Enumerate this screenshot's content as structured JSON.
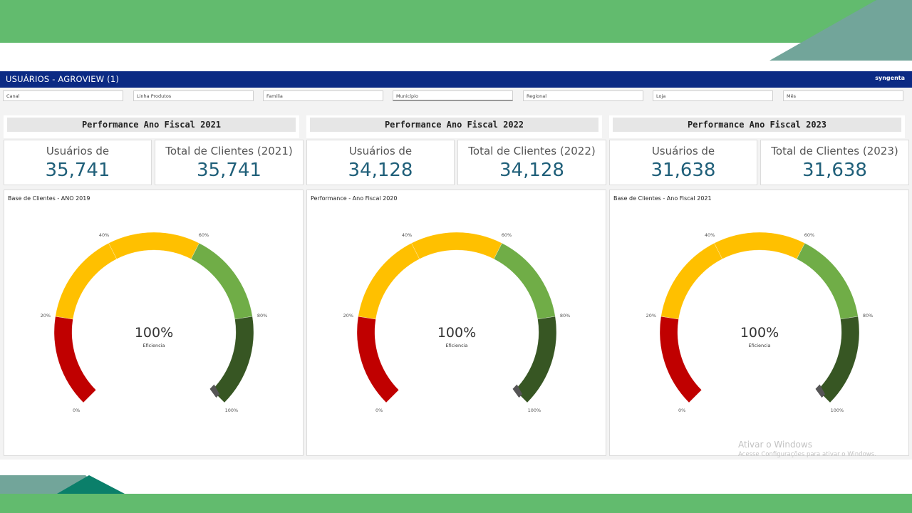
{
  "app": {
    "title": "USUÁRIOS - AGROVIEW (1)",
    "brand": "syngenta"
  },
  "filters": [
    {
      "label": "Canal",
      "active": false
    },
    {
      "label": "Linha Produtos",
      "active": false
    },
    {
      "label": "Familia",
      "active": false
    },
    {
      "label": "Município",
      "active": true
    },
    {
      "label": "Regional",
      "active": false
    },
    {
      "label": "Loja",
      "active": false
    },
    {
      "label": "Mês",
      "active": false
    }
  ],
  "panels": [
    {
      "header": "Performance Ano Fiscal 2021",
      "kpis": [
        {
          "label": "Usuários de",
          "value": "35,741"
        },
        {
          "label": "Total de Clientes (2021)",
          "value": "35,741"
        }
      ],
      "gauge": {
        "title": "Base de Clientes - ANO 2019",
        "value_text": "100%",
        "value": 100,
        "sub": "Eficiencia",
        "ticks": [
          "0%",
          "20%",
          "40%",
          "60%",
          "80%",
          "100%"
        ]
      }
    },
    {
      "header": "Performance Ano Fiscal 2022",
      "kpis": [
        {
          "label": "Usuários de",
          "value": "34,128"
        },
        {
          "label": "Total de Clientes (2022)",
          "value": "34,128"
        }
      ],
      "gauge": {
        "title": "Performance - Ano Fiscal 2020",
        "value_text": "100%",
        "value": 100,
        "sub": "Eficiencia",
        "ticks": [
          "0%",
          "20%",
          "40%",
          "60%",
          "80%",
          "100%"
        ]
      }
    },
    {
      "header": "Performance Ano Fiscal 2023",
      "kpis": [
        {
          "label": "Usuários de",
          "value": "31,638"
        },
        {
          "label": "Total de Clientes (2023)",
          "value": "31,638"
        }
      ],
      "gauge": {
        "title": "Base de Clientes - Ano Fiscal 2021",
        "value_text": "100%",
        "value": 100,
        "sub": "Eficiencia",
        "ticks": [
          "0%",
          "20%",
          "40%",
          "60%",
          "80%",
          "100%"
        ]
      }
    }
  ],
  "gauge_bands": [
    {
      "from": 0,
      "to": 20,
      "color": "#c00000"
    },
    {
      "from": 20,
      "to": 40,
      "color": "#ffc000"
    },
    {
      "from": 40,
      "to": 60,
      "color": "#ffc000"
    },
    {
      "from": 60,
      "to": 80,
      "color": "#70ad47"
    },
    {
      "from": 80,
      "to": 100,
      "color": "#375623"
    }
  ],
  "colors": {
    "header": "#0b2a84",
    "accent_green": "#62bb6e",
    "kpi_value": "#1f5f79",
    "needle": "#555555"
  },
  "watermark": {
    "title": "Ativar o Windows",
    "subtitle": "Acesse Configurações para ativar o Windows."
  }
}
